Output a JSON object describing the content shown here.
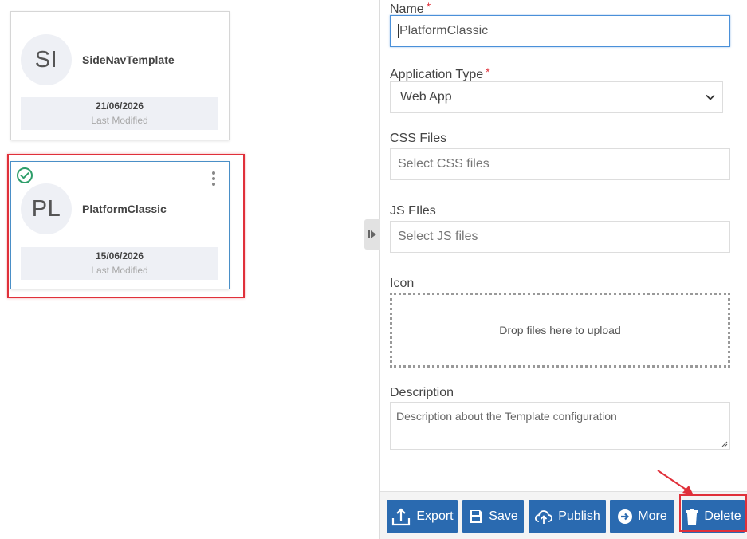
{
  "templates": [
    {
      "initials": "SI",
      "name": "SideNavTemplate",
      "date": "21/06/2026",
      "modified_label": "Last Modified"
    },
    {
      "initials": "PL",
      "name": "PlatformClassic",
      "date": "15/06/2026",
      "modified_label": "Last Modified"
    }
  ],
  "form": {
    "name_label": "Name",
    "name_value": "PlatformClassic",
    "required_mark": "*",
    "app_type_label": "Application Type",
    "app_type_value": "Web App",
    "css_label": "CSS Files",
    "css_placeholder": "Select CSS files",
    "js_label": "JS FIles",
    "js_placeholder": "Select JS files",
    "icon_label": "Icon",
    "dropzone_text": "Drop files here to upload",
    "description_label": "Description",
    "description_value": "Description about the Template configuration"
  },
  "toolbar": {
    "export_label": "Export",
    "save_label": "Save",
    "publish_label": "Publish",
    "more_label": "More",
    "delete_label": "Delete"
  },
  "colors": {
    "primary": "#2a6ab0",
    "highlight": "#e0303a",
    "success": "#2e9e6a"
  }
}
